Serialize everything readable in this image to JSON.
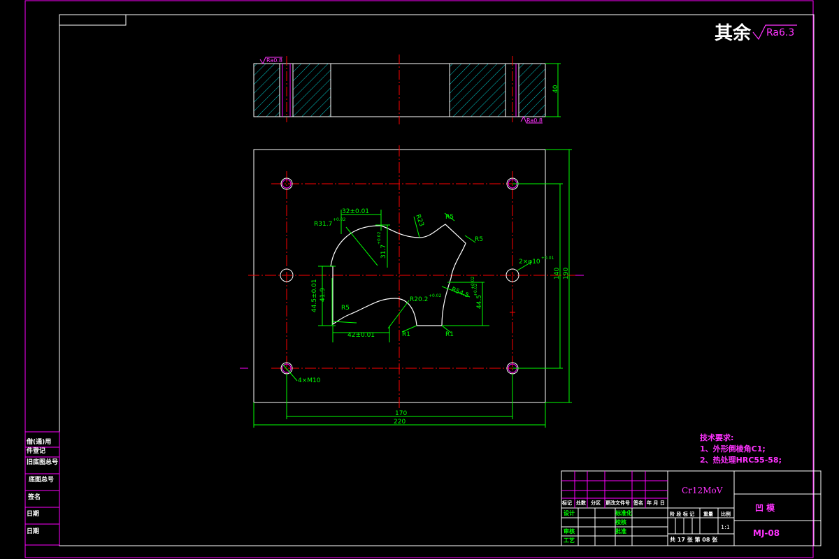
{
  "roughness": {
    "general_prefix": "其余",
    "general_value": "Ra6.3",
    "section_left": "Ra0.8",
    "section_right": "Ra0.8"
  },
  "dimensions": {
    "thickness": "40",
    "height_outer": "190",
    "height_holes": "140",
    "width_holes": "170",
    "width_outer": "220",
    "top_width": "32±0.01",
    "top_radius": "R31.7",
    "top_radius_tol": "+0.02",
    "top_depth": "31.7",
    "top_depth_tol": "+0.02",
    "r23": "R23",
    "r5_top": "R5",
    "r5_right": "R5",
    "pin_holes": "2×φ10",
    "pin_holes_tol": "+0.01",
    "left_h1": "44.5±0.01",
    "left_h2": "41.9",
    "r5_bottom": "R5",
    "r20": "R20.2",
    "r20_tol": "+0.02",
    "r54": "R54.5",
    "r54_tol": "+0.02",
    "right_h": "44.5",
    "right_h_tol": "+0.02",
    "r1_left": "R1",
    "r1_right": "R1",
    "bottom_width": "42±0.01",
    "thread": "4×M10"
  },
  "tech_requirements": {
    "title": "技术要求:",
    "item1": "1、外形倒棱角C1;",
    "item2": "2、热处理HRC55-58;"
  },
  "left_strip": [
    "借(通)用",
    "件登记",
    "旧底图总号",
    "底图总号",
    "签名",
    "日期",
    "日期"
  ],
  "title_block": {
    "material": "Cr12MoV",
    "part_name": "凹  模",
    "drawing_no": "MJ-08",
    "scale": "1:1",
    "sheet_info": "共 17 张    第 08 张",
    "stage_header": "阶 段 标 记",
    "weight_header": "重量",
    "scale_header": "比例",
    "rev_headers": [
      "标记",
      "处数",
      "分区",
      "更改文件号",
      "签名",
      "年 月 日"
    ],
    "row_design": "设计",
    "row_standard": "标准化",
    "row_proof": "校核",
    "row_review": "审核",
    "row_process": "工艺",
    "row_approve": "批准"
  },
  "colors": {
    "frame": "#ff00ff",
    "outline": "#ffffff",
    "dimension": "#00ff00",
    "centerline": "#ff0000",
    "hatch": "#00ffff",
    "text_magenta": "#ff33ff",
    "title_label": "#00ff00"
  }
}
